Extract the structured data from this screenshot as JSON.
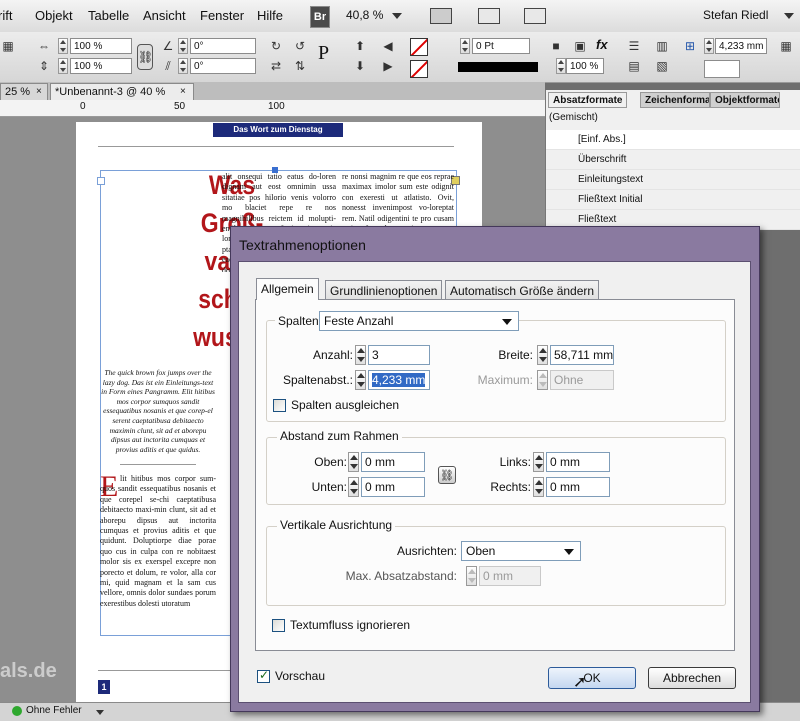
{
  "menubar": {
    "items": [
      "rift",
      "Objekt",
      "Tabelle",
      "Ansicht",
      "Fenster",
      "Hilfe"
    ],
    "br_label": "Br",
    "zoom": "40,8 %",
    "user": "Stefan Riedl"
  },
  "controlbar": {
    "scale_x": "100 %",
    "scale_y": "100 %",
    "angle1": "0°",
    "angle2": "0°",
    "stroke_weight": "0 Pt",
    "opacity": "100 %",
    "gutter": "4,233 mm"
  },
  "doctabs": {
    "tab1": "25 %",
    "tab2": "*Unbenannt-3 @ 40 %"
  },
  "ruler": {
    "n0": "0",
    "n50": "50",
    "n100": "100"
  },
  "document": {
    "banner": "Das Wort zum Dienstag",
    "headline": [
      "Was",
      "Groß-",
      "vater",
      "schon",
      "wusste"
    ],
    "intro": "The quick brown fox jumps over the lazy dog. Das ist ein Einleitungs-text in Form eines Pangramm. Elit hitibus mos corpor sumquos sandit essequatibus nosanis et que corep-el serent caeptatibusa debitaecto maximin clunt, sit ad et aborepu dipsus aut inctorita cumquas et provius aditis et que quidus.",
    "drop_cap": "E",
    "col1": "lit hitibus mos corpor sum-quos sandit essequatibus nosanis et que corepel se-chi caeptatibusa debitaecto maxi-min clunt, sit ad et aborepu dipsus aut inctorita cumquas et provius aditis et que quidunt. Doluptiorpe diae porae quo cus in culpa con re nobitaest molor sis ex exerspel excepre non porecto et dolum, re volor, alla cor mi, quid magnam et la sam cus vellore, omnis dolor sundaes porum exerestibus dolesti utoratum",
    "col2": "alit onsequi tatio eatus do-loren dignam aut eost omnimin ussa sitatiae pos hilorio venis volorro mo blaciet repe re nos magnihilibus reictem id molupti-entibus exerum fugit reiusa nia lorias autem pers quatios vele ptabit eumque sequat quam aut et eaquatio. Itatur si nusam aut doloria",
    "col3": "re nonsi magnim re que eos repraе maximax imolor sum este odignit con exeresti ut atlatisto. Ovit, nonesst invenimpost vo-loreptat rem. Natil odigentini te pro cusam estium facca-borem nimus"
  },
  "panel": {
    "tabs": [
      "Absatzformate",
      "Zeichenforma",
      "Objektformate"
    ],
    "subtitle": "(Gemischt)",
    "styles": [
      "[Einf. Abs.]",
      "Überschrift",
      "Einleitungstext",
      "Fließtext Initial",
      "Fließtext"
    ]
  },
  "statusbar": {
    "page": "1",
    "preflight": "Ohne Fehler",
    "watermark": "als.de"
  },
  "dialog": {
    "title": "Textrahmenoptionen",
    "tabs": [
      "Allgemein",
      "Grundlinienoptionen",
      "Automatisch Größe ändern"
    ],
    "columns": {
      "label": "Spalten:",
      "mode": "Feste Anzahl",
      "count_label": "Anzahl:",
      "count": "3",
      "width_label": "Breite:",
      "width": "58,711 mm",
      "gutter_label": "Spaltenabst.:",
      "gutter": "4,233 mm",
      "max_label": "Maximum:",
      "max": "Ohne",
      "balance_label": "Spalten ausgleichen"
    },
    "inset": {
      "title": "Abstand zum Rahmen",
      "top_label": "Oben:",
      "top": "0 mm",
      "bottom_label": "Unten:",
      "bottom": "0 mm",
      "left_label": "Links:",
      "left": "0 mm",
      "right_label": "Rechts:",
      "right": "0 mm"
    },
    "vertical": {
      "title": "Vertikale Ausrichtung",
      "align_label": "Ausrichten:",
      "align": "Oben",
      "maxspace_label": "Max. Absatzabstand:",
      "maxspace": "0 mm"
    },
    "ignore_wrap_label": "Textumfluss ignorieren",
    "preview_label": "Vorschau",
    "ok": "OK",
    "cancel": "Abbrechen"
  }
}
